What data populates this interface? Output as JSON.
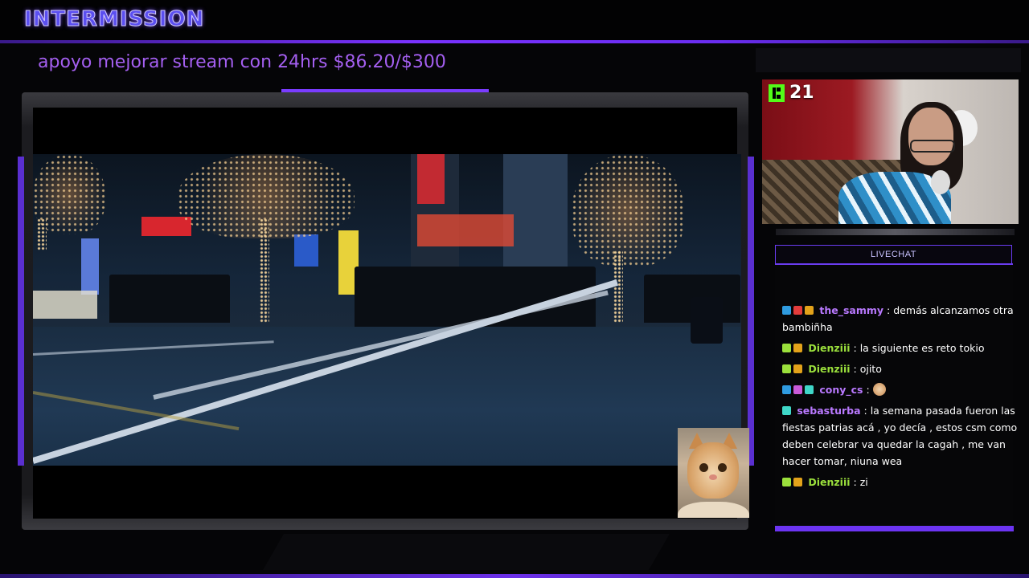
{
  "overlay": {
    "title": "INTERMISSION",
    "goal_text": "apoyo mejorar stream con 24hrs $86.20/$300"
  },
  "webcam": {
    "platform_icon": "kick-icon",
    "viewer_count": "21"
  },
  "chat": {
    "header": "LIVECHAT",
    "messages": [
      {
        "badges": [
          "blue",
          "red",
          "gold"
        ],
        "user": "the_sammy",
        "user_color": "#b979ff",
        "text": "demás alcanzamos otra bambiñha"
      },
      {
        "badges": [
          "green",
          "gold"
        ],
        "user": "Dienziii",
        "user_color": "#9be03c",
        "text": "la siguiente es reto tokio"
      },
      {
        "badges": [
          "green",
          "gold"
        ],
        "user": "Dienziii",
        "user_color": "#9be03c",
        "text": "ojito"
      },
      {
        "badges": [
          "blue",
          "pink",
          "teal"
        ],
        "user": "cony_cs",
        "user_color": "#b979ff",
        "text": "",
        "emote": "cat-emote-icon"
      },
      {
        "badges": [
          "teal"
        ],
        "user": "sebasturba",
        "user_color": "#b979ff",
        "text": "la semana pasada fueron las fiestas patrias acá , yo decía , estos csm como deben celebrar va quedar la cagah , me van hacer tomar, niuna wea"
      },
      {
        "badges": [
          "green",
          "gold"
        ],
        "user": "Dienziii",
        "user_color": "#9be03c",
        "text": "zi"
      }
    ]
  },
  "colors": {
    "accent": "#6c34f2",
    "goal": "#a45ff0",
    "kick_green": "#53fc18"
  }
}
